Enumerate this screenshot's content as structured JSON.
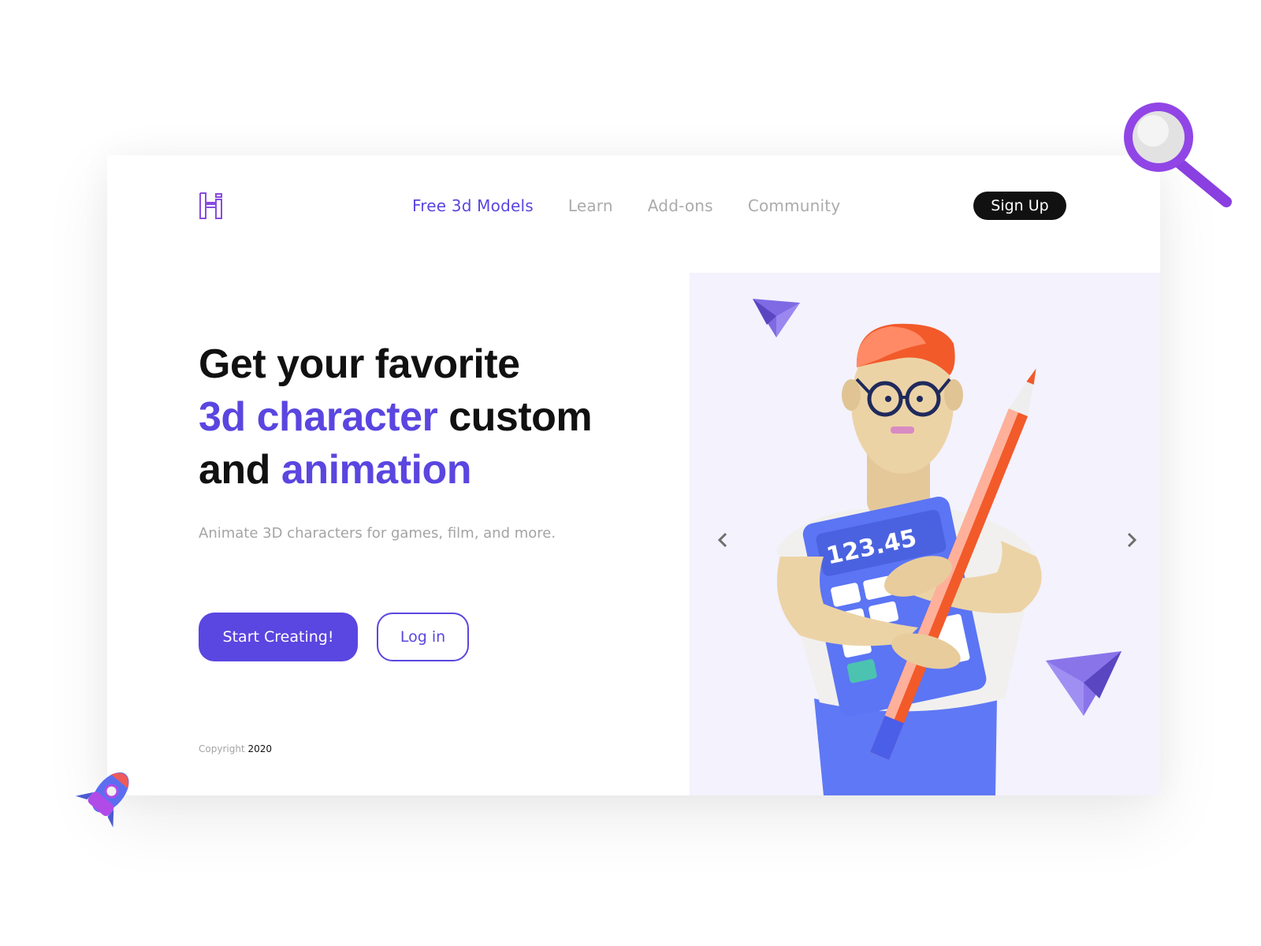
{
  "brand": {
    "logo_icon": "h-outline-logo",
    "accent_color": "#5a46e0"
  },
  "nav": {
    "items": [
      {
        "label": "Free 3d Models",
        "active": true
      },
      {
        "label": "Learn",
        "active": false
      },
      {
        "label": "Add-ons",
        "active": false
      },
      {
        "label": "Community",
        "active": false
      }
    ],
    "signup_label": "Sign Up"
  },
  "hero": {
    "headline": {
      "line1": "Get your favorite",
      "line2_highlight": "3d character",
      "line2_rest": " custom",
      "line3_start": "and ",
      "line3_highlight": "animation"
    },
    "subtext": "Animate 3D characters for games, film, and more.",
    "primary_button": "Start Creating!",
    "secondary_button": "Log in",
    "illustration": {
      "description": "3D character with red hair and glasses holding a calculator and pencil",
      "calculator_display": "123.45",
      "prev_icon": "chevron-left-icon",
      "next_icon": "chevron-right-icon"
    }
  },
  "footer": {
    "copyright_label": "Copyright",
    "copyright_year": "2020"
  },
  "decorations": {
    "top_right": "magnifier-icon",
    "bottom_left": "rocket-icon"
  }
}
